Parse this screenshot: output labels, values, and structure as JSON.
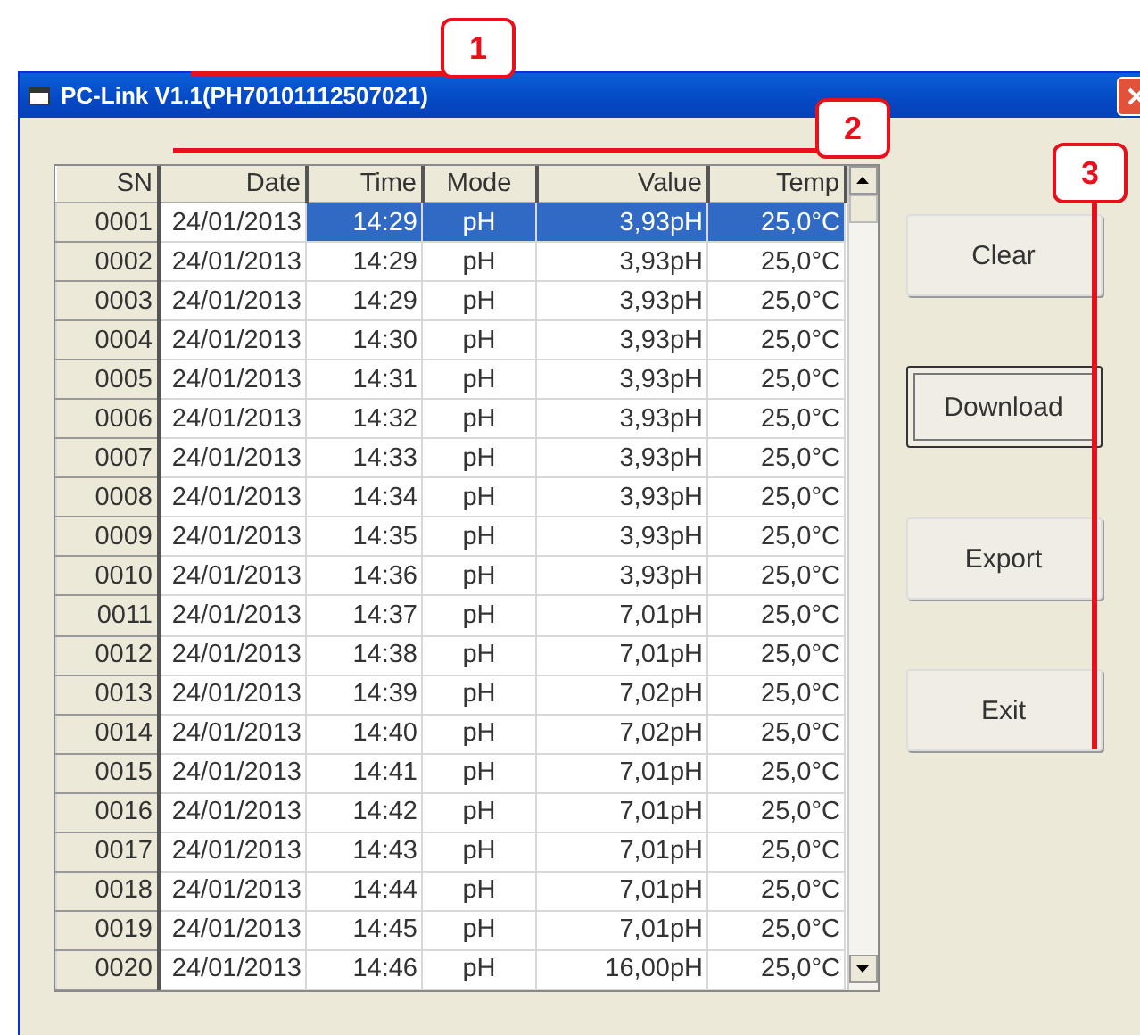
{
  "window": {
    "title": "PC-Link V1.1(PH70101112507021)"
  },
  "table": {
    "columns": [
      "SN",
      "Date",
      "Time",
      "Mode",
      "Value",
      "Temp"
    ],
    "rows": [
      {
        "cells": [
          "0001",
          "24/01/2013",
          "14:29",
          "pH",
          "3,93pH",
          "25,0°C"
        ],
        "selected": true
      },
      {
        "cells": [
          "0002",
          "24/01/2013",
          "14:29",
          "pH",
          "3,93pH",
          "25,0°C"
        ],
        "selected": false
      },
      {
        "cells": [
          "0003",
          "24/01/2013",
          "14:29",
          "pH",
          "3,93pH",
          "25,0°C"
        ],
        "selected": false
      },
      {
        "cells": [
          "0004",
          "24/01/2013",
          "14:30",
          "pH",
          "3,93pH",
          "25,0°C"
        ],
        "selected": false
      },
      {
        "cells": [
          "0005",
          "24/01/2013",
          "14:31",
          "pH",
          "3,93pH",
          "25,0°C"
        ],
        "selected": false
      },
      {
        "cells": [
          "0006",
          "24/01/2013",
          "14:32",
          "pH",
          "3,93pH",
          "25,0°C"
        ],
        "selected": false
      },
      {
        "cells": [
          "0007",
          "24/01/2013",
          "14:33",
          "pH",
          "3,93pH",
          "25,0°C"
        ],
        "selected": false
      },
      {
        "cells": [
          "0008",
          "24/01/2013",
          "14:34",
          "pH",
          "3,93pH",
          "25,0°C"
        ],
        "selected": false
      },
      {
        "cells": [
          "0009",
          "24/01/2013",
          "14:35",
          "pH",
          "3,93pH",
          "25,0°C"
        ],
        "selected": false
      },
      {
        "cells": [
          "0010",
          "24/01/2013",
          "14:36",
          "pH",
          "3,93pH",
          "25,0°C"
        ],
        "selected": false
      },
      {
        "cells": [
          "0011",
          "24/01/2013",
          "14:37",
          "pH",
          "7,01pH",
          "25,0°C"
        ],
        "selected": false
      },
      {
        "cells": [
          "0012",
          "24/01/2013",
          "14:38",
          "pH",
          "7,01pH",
          "25,0°C"
        ],
        "selected": false
      },
      {
        "cells": [
          "0013",
          "24/01/2013",
          "14:39",
          "pH",
          "7,02pH",
          "25,0°C"
        ],
        "selected": false
      },
      {
        "cells": [
          "0014",
          "24/01/2013",
          "14:40",
          "pH",
          "7,02pH",
          "25,0°C"
        ],
        "selected": false
      },
      {
        "cells": [
          "0015",
          "24/01/2013",
          "14:41",
          "pH",
          "7,01pH",
          "25,0°C"
        ],
        "selected": false
      },
      {
        "cells": [
          "0016",
          "24/01/2013",
          "14:42",
          "pH",
          "7,01pH",
          "25,0°C"
        ],
        "selected": false
      },
      {
        "cells": [
          "0017",
          "24/01/2013",
          "14:43",
          "pH",
          "7,01pH",
          "25,0°C"
        ],
        "selected": false
      },
      {
        "cells": [
          "0018",
          "24/01/2013",
          "14:44",
          "pH",
          "7,01pH",
          "25,0°C"
        ],
        "selected": false
      },
      {
        "cells": [
          "0019",
          "24/01/2013",
          "14:45",
          "pH",
          "7,01pH",
          "25,0°C"
        ],
        "selected": false
      },
      {
        "cells": [
          "0020",
          "24/01/2013",
          "14:46",
          "pH",
          "16,00pH",
          "25,0°C"
        ],
        "selected": false
      }
    ]
  },
  "buttons": [
    {
      "label": "Clear",
      "focused": false
    },
    {
      "label": "Download",
      "focused": true
    },
    {
      "label": "Export",
      "focused": false
    },
    {
      "label": "Exit",
      "focused": false
    }
  ],
  "callouts": [
    {
      "label": "1"
    },
    {
      "label": "2"
    },
    {
      "label": "3"
    }
  ]
}
